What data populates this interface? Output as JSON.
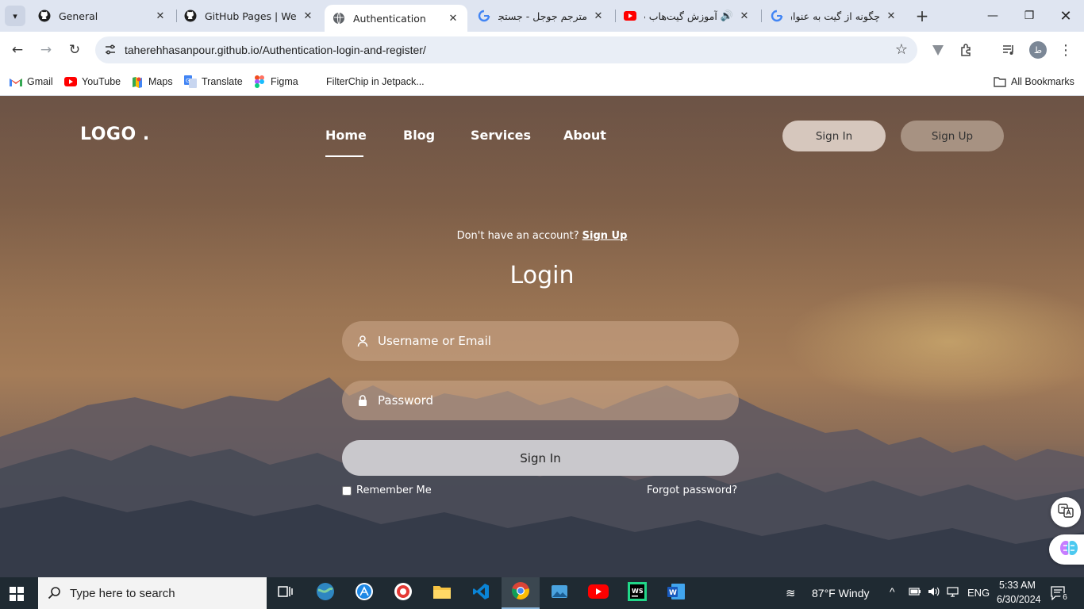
{
  "browser": {
    "tabs": [
      {
        "title": "General",
        "active": false
      },
      {
        "title": "GitHub Pages | Websi",
        "active": false
      },
      {
        "title": "Authentication",
        "active": true
      },
      {
        "title": "مترجم جوجل - جستجو",
        "active": false
      },
      {
        "title": "آموزش گیت‌هاب پ",
        "active": false
      },
      {
        "title": "چگونه از گیت به عنوان",
        "active": false
      }
    ],
    "url": "taherehhasanpour.github.io/Authentication-login-and-register/",
    "profile_initial": "ط",
    "bookmarks": [
      {
        "label": "Gmail",
        "icon": "gmail-icon"
      },
      {
        "label": "YouTube",
        "icon": "youtube-icon"
      },
      {
        "label": "Maps",
        "icon": "maps-icon"
      },
      {
        "label": "Translate",
        "icon": "translate-icon"
      },
      {
        "label": "Figma",
        "icon": "figma-icon"
      },
      {
        "label": "FilterChip in Jetpack...",
        "icon": ""
      }
    ],
    "all_bookmarks": "All Bookmarks"
  },
  "site": {
    "logo": "LOGO .",
    "nav": [
      {
        "label": "Home",
        "active": true
      },
      {
        "label": "Blog",
        "active": false
      },
      {
        "label": "Services",
        "active": false
      },
      {
        "label": "About",
        "active": false
      }
    ],
    "sign_in": "Sign In",
    "sign_up": "Sign Up"
  },
  "login": {
    "prompt": "Don't have an account?",
    "prompt_link": "Sign Up",
    "title": "Login",
    "username_placeholder": "Username or Email",
    "password_placeholder": "Password",
    "submit": "Sign In",
    "remember": "Remember Me",
    "forgot": "Forgot password?"
  },
  "taskbar": {
    "search_placeholder": "Type here to search",
    "weather": "87°F  Windy",
    "lang": "ENG",
    "time": "5:33 AM",
    "date": "6/30/2024",
    "notifications": "6"
  },
  "colors": {
    "accent_signin": "#d6c7bd",
    "accent_signup": "#a79282",
    "submit_bg": "#c9c8cc"
  }
}
